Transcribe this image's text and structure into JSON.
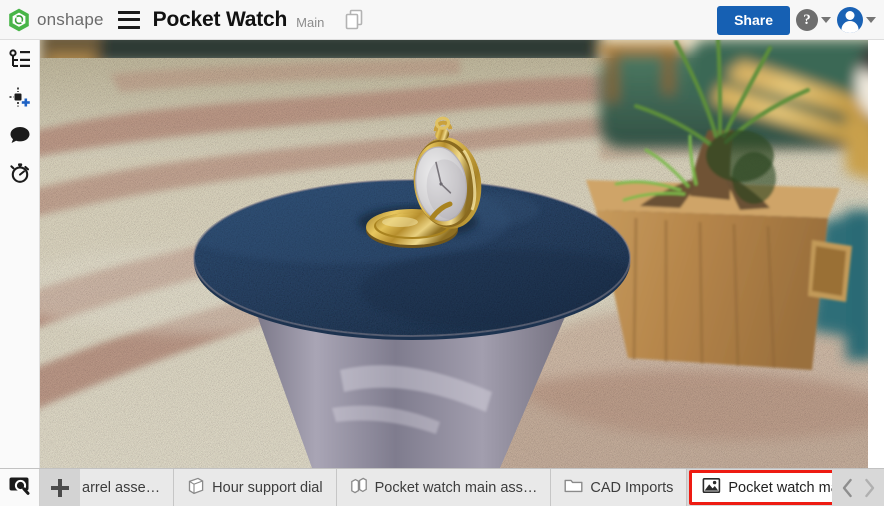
{
  "header": {
    "brand_name": "onshape",
    "logo_icon": "onshape-logo-icon",
    "menu_icon": "hamburger-menu-icon",
    "document_title": "Pocket Watch",
    "workspace_name": "Main",
    "copy_icon": "copy-documents-icon",
    "share_label": "Share",
    "help_glyph": "?",
    "help_icon": "help-circle-icon",
    "help_caret_icon": "chevron-down-icon",
    "avatar_icon": "user-avatar-icon",
    "avatar_caret_icon": "chevron-down-icon",
    "share_color": "#1660b3"
  },
  "sidebar": {
    "items": [
      {
        "name": "feature-tree-icon",
        "label": "Feature list"
      },
      {
        "name": "insert-instance-icon",
        "label": "Insert"
      },
      {
        "name": "comment-icon",
        "label": "Comments"
      },
      {
        "name": "stopwatch-icon",
        "label": "History"
      }
    ]
  },
  "viewport": {
    "scene_name": "pocket-watch-render",
    "description": "Rendered photo of a gold pocket watch standing open on a round blue-carpet-topped pedestal table in a lobby, with a wooden planter, green sofa and wooden railing behind.",
    "colors": {
      "table_top": "#2c4a6e",
      "pedestal": "#8a8796",
      "floor_light": "#e4dcc4",
      "floor_pink": "#c49887",
      "watch_gold": "#caa13c",
      "sofa_green": "#3f6b57",
      "planter_wood": "#b78a4e",
      "rail_wood": "#d2a957"
    }
  },
  "tabbar": {
    "search_icon": "tab-search-icon",
    "add_icon": "add-tab-icon",
    "prev_icon": "chevron-left-icon",
    "next_icon": "chevron-right-icon",
    "tabs": [
      {
        "label": "arrel asse…",
        "icon": "part-studio-icon",
        "highlighted": false
      },
      {
        "label": "Hour support dial",
        "icon": "part-studio-icon",
        "highlighted": false
      },
      {
        "label": "Pocket watch main ass…",
        "icon": "assembly-icon",
        "highlighted": false
      },
      {
        "label": "CAD Imports",
        "icon": "folder-icon",
        "highlighted": false
      },
      {
        "label": "Pocket watch main ass…",
        "icon": "image-icon",
        "highlighted": true
      }
    ],
    "highlight_color": "#ee1b12"
  }
}
